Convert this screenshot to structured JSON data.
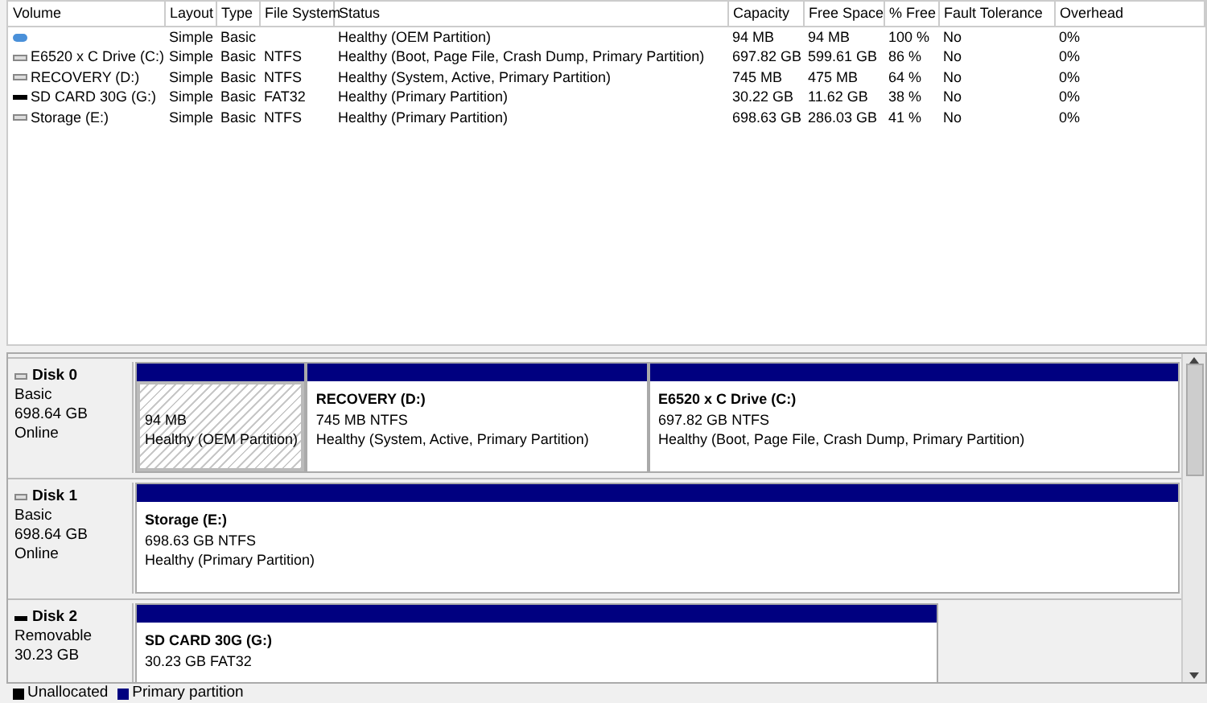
{
  "volume_table": {
    "columns": [
      "Volume",
      "Layout",
      "Type",
      "File System",
      "Status",
      "Capacity",
      "Free Space",
      "% Free",
      "Fault Tolerance",
      "Overhead"
    ],
    "rows": [
      {
        "kind": "oem",
        "cells": [
          "",
          "Simple",
          "Basic",
          "",
          "Healthy (OEM Partition)",
          "94 MB",
          "94 MB",
          "100 %",
          "No",
          "0%"
        ]
      },
      {
        "kind": "disk",
        "cells": [
          "E6520 x C Drive (C:)",
          "Simple",
          "Basic",
          "NTFS",
          "Healthy (Boot, Page File, Crash Dump, Primary Partition)",
          "697.82 GB",
          "599.61 GB",
          "86 %",
          "No",
          "0%"
        ]
      },
      {
        "kind": "disk",
        "cells": [
          "RECOVERY (D:)",
          "Simple",
          "Basic",
          "NTFS",
          "Healthy (System, Active, Primary Partition)",
          "745 MB",
          "475 MB",
          "64 %",
          "No",
          "0%"
        ]
      },
      {
        "kind": "removable",
        "cells": [
          "SD CARD 30G (G:)",
          "Simple",
          "Basic",
          "FAT32",
          "Healthy (Primary Partition)",
          "30.22 GB",
          "11.62 GB",
          "38 %",
          "No",
          "0%"
        ]
      },
      {
        "kind": "disk",
        "cells": [
          "Storage  (E:)",
          "Simple",
          "Basic",
          "NTFS",
          "Healthy (Primary Partition)",
          "698.63 GB",
          "286.03 GB",
          "41 %",
          "No",
          "0%"
        ]
      }
    ]
  },
  "disks": [
    {
      "kind": "disk",
      "name": "Disk 0",
      "info": [
        "Basic",
        "698.64 GB",
        "Online"
      ],
      "partitions": [
        {
          "kind": "oem",
          "lines": [
            "94 MB",
            "Healthy (OEM Partition)"
          ]
        },
        {
          "kind": "primary",
          "title": "RECOVERY  (D:)",
          "lines": [
            "745 MB NTFS",
            "Healthy (System, Active, Primary Partition)"
          ]
        },
        {
          "kind": "primary",
          "title": "E6520 x C Drive  (C:)",
          "lines": [
            "697.82 GB NTFS",
            "Healthy (Boot, Page File, Crash Dump, Primary Partition)"
          ]
        }
      ]
    },
    {
      "kind": "disk",
      "name": "Disk 1",
      "info": [
        "Basic",
        "698.64 GB",
        "Online"
      ],
      "partitions": [
        {
          "kind": "primary",
          "title": "Storage   (E:)",
          "lines": [
            "698.63 GB NTFS",
            "Healthy (Primary Partition)"
          ]
        }
      ]
    },
    {
      "kind": "removable",
      "name": "Disk 2",
      "info": [
        "Removable",
        "30.23 GB"
      ],
      "partitions": [
        {
          "kind": "primary",
          "title": "SD CARD 30G  (G:)",
          "lines": [
            "30.23 GB FAT32"
          ]
        }
      ]
    }
  ],
  "legend": [
    {
      "label": "Unallocated",
      "color": "#000000"
    },
    {
      "label": "Primary partition",
      "color": "#000080"
    }
  ]
}
